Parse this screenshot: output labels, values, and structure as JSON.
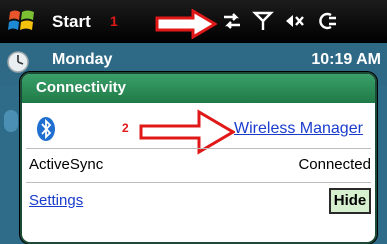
{
  "taskbar": {
    "start_label": "Start",
    "annotation_1": "1",
    "icons": [
      "connectivity-icon",
      "signal-antenna-icon",
      "volume-icon",
      "activesync-icon"
    ]
  },
  "today": {
    "day": "Monday",
    "time": "10:19 AM"
  },
  "popup": {
    "title": "Connectivity",
    "annotation_2": "2",
    "wireless_link": "Wireless Manager",
    "activesync_label": "ActiveSync",
    "activesync_status": "Connected",
    "settings_link": "Settings",
    "hide_button": "Hide"
  },
  "colors": {
    "annotation_red": "#e01818",
    "header_green": "#2a8a55",
    "link_blue": "#1a3ccc"
  }
}
